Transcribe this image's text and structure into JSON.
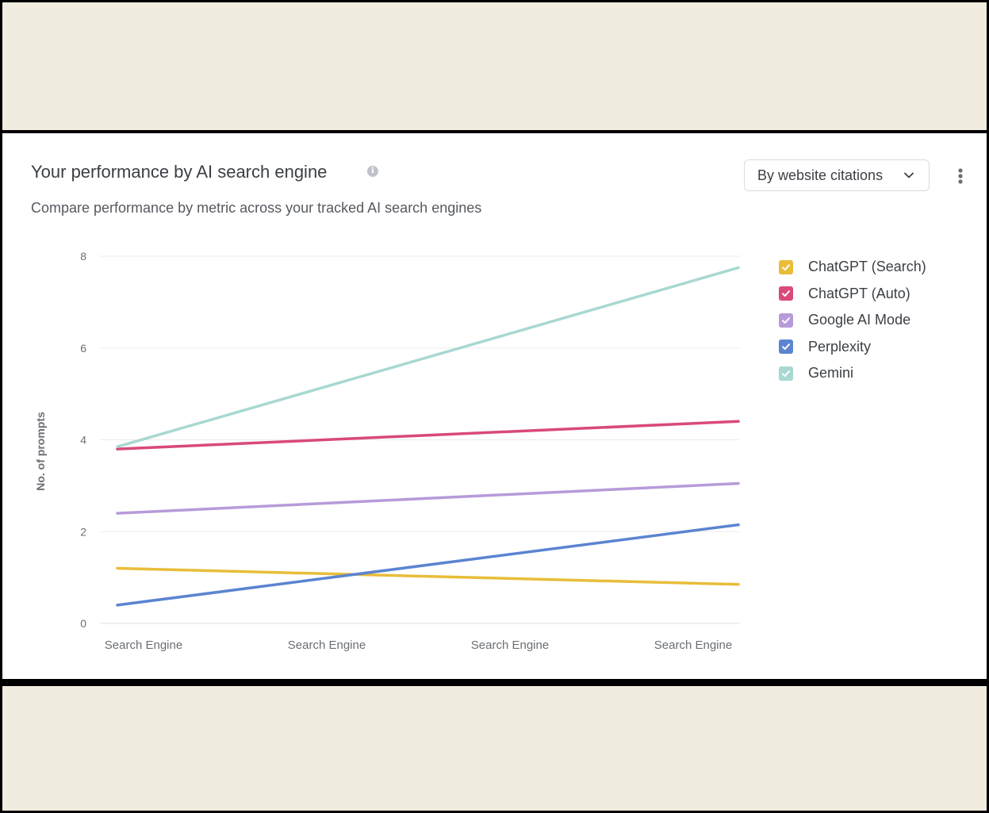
{
  "card": {
    "title": "Your performance by AI search engine",
    "subtitle": "Compare performance by metric across your tracked AI search engines",
    "metric_select": "By website citations",
    "icons": [
      "info-icon",
      "chevron-down-icon",
      "more-vertical-icon",
      "checkbox-icon"
    ]
  },
  "colors": {
    "background_band": "#f0ecdf",
    "frame": "#000000",
    "card": "#ffffff",
    "gridline": "#ececec"
  },
  "chart_data": {
    "type": "line",
    "title": "",
    "xlabel": "",
    "ylabel": "No. of prompts",
    "ylim": [
      0,
      8
    ],
    "yticks": [
      0,
      2,
      4,
      6,
      8
    ],
    "grid": true,
    "legend_position": "right",
    "categories": [
      "Search Engine",
      "Search Engine",
      "Search Engine",
      "Search Engine"
    ],
    "series": [
      {
        "name": "ChatGPT (Search)",
        "color": "#e9bd3a",
        "x": [
          0,
          3
        ],
        "y": [
          1.2,
          0.85
        ]
      },
      {
        "name": "ChatGPT (Auto)",
        "color": "#d9497a",
        "x": [
          0,
          3
        ],
        "y": [
          3.8,
          4.4
        ]
      },
      {
        "name": "Google AI Mode",
        "color": "#b79bd9",
        "x": [
          0,
          3
        ],
        "y": [
          2.4,
          3.05
        ]
      },
      {
        "name": "Perplexity",
        "color": "#5b84d1",
        "x": [
          0,
          3
        ],
        "y": [
          0.4,
          2.15
        ]
      },
      {
        "name": "Gemini",
        "color": "#a8d8d2",
        "x": [
          0,
          3
        ],
        "y": [
          3.85,
          7.75
        ]
      }
    ]
  }
}
